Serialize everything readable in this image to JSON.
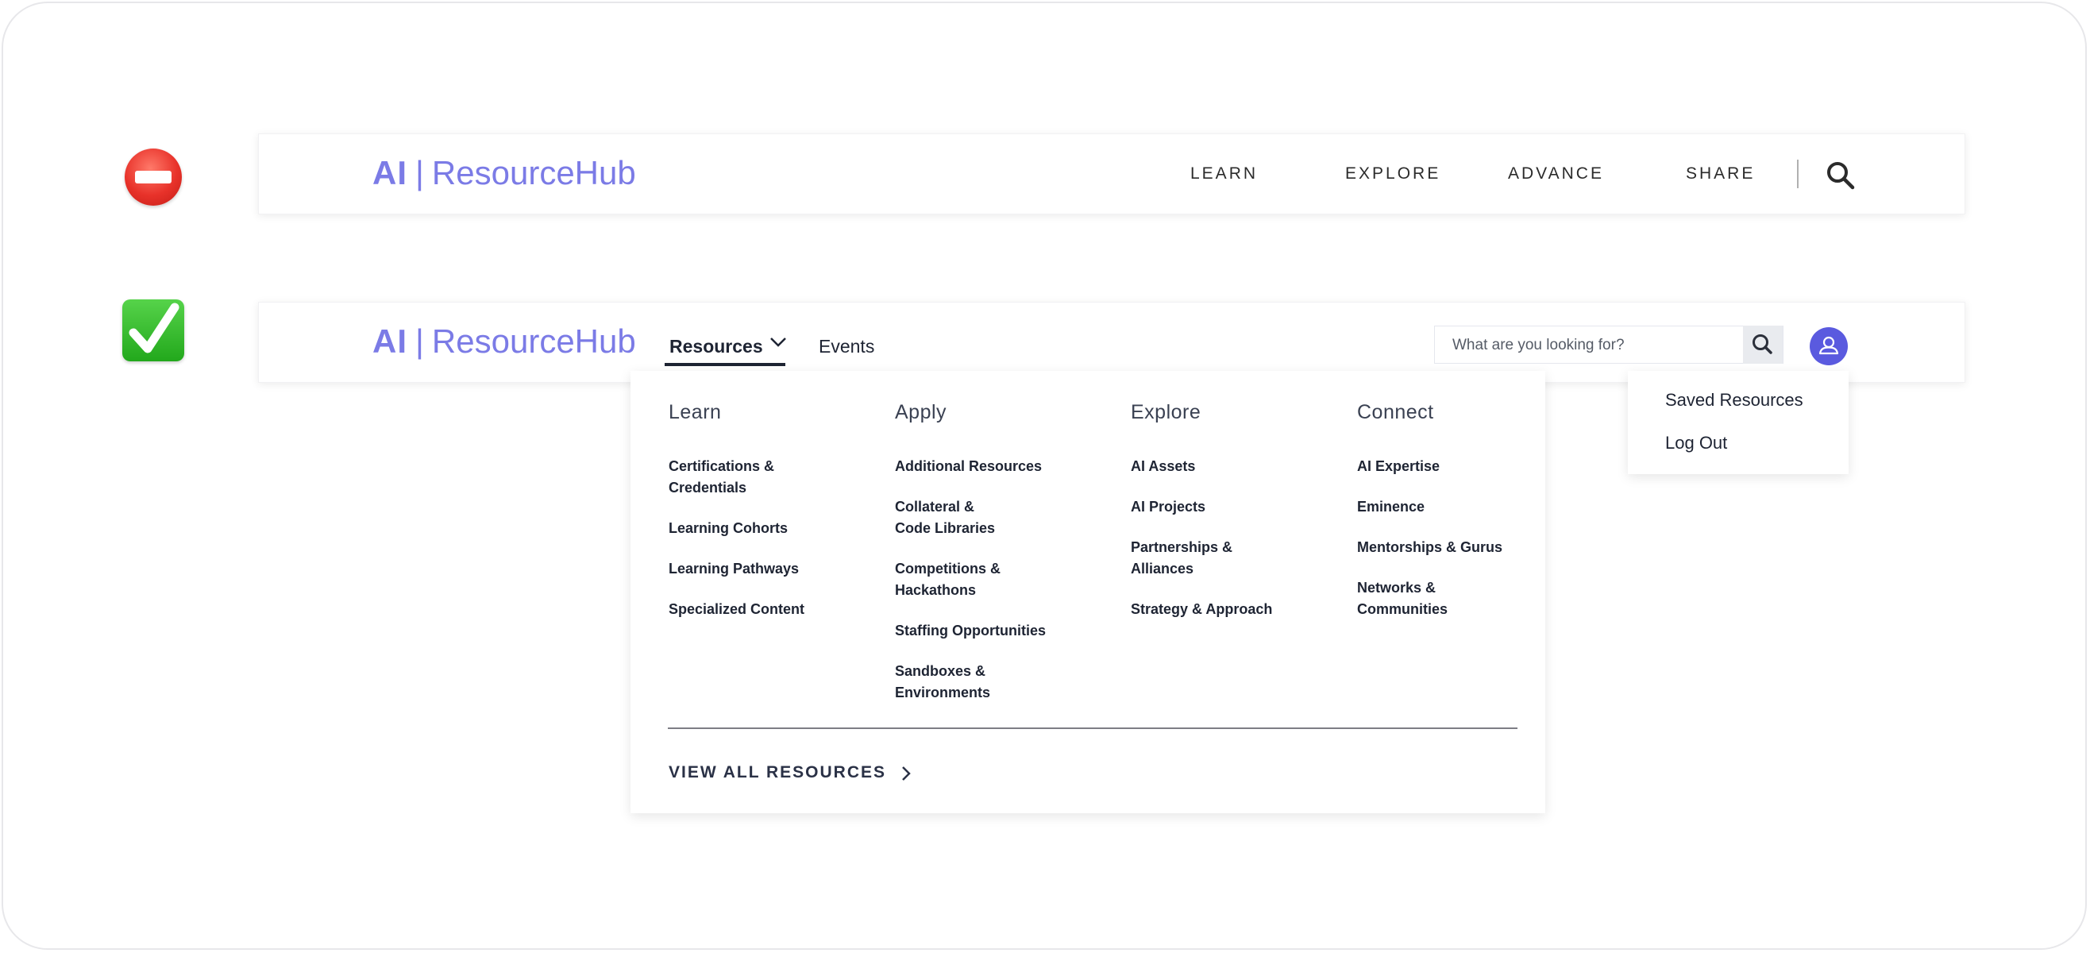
{
  "logo": {
    "ai": "AI",
    "separator": "|",
    "name": "ResourceHub"
  },
  "old_nav": {
    "items": [
      "LEARN",
      "EXPLORE",
      "ADVANCE",
      "SHARE"
    ]
  },
  "new_nav": {
    "resources_label": "Resources",
    "events_label": "Events",
    "search_placeholder": "What are you looking for?"
  },
  "mega_menu": {
    "columns": [
      {
        "heading": "Learn",
        "items": [
          "Certifications &\nCredentials",
          "Learning Cohorts",
          "Learning Pathways",
          "Specialized Content"
        ]
      },
      {
        "heading": "Apply",
        "items": [
          "Additional Resources",
          "Collateral &\nCode Libraries",
          "Competitions &\nHackathons",
          "Staffing Opportunities",
          "Sandboxes &\nEnvironments"
        ]
      },
      {
        "heading": "Explore",
        "items": [
          "AI Assets",
          "AI Projects",
          "Partnerships &\nAlliances",
          "Strategy & Approach"
        ]
      },
      {
        "heading": "Connect",
        "items": [
          "AI Expertise",
          "Eminence",
          "Mentorships & Gurus",
          "Networks &\nCommunities"
        ]
      }
    ],
    "view_all_label": "VIEW ALL RESOURCES"
  },
  "user_menu": {
    "items": [
      "Saved Resources",
      "Log Out"
    ]
  },
  "colors": {
    "brand": "#7b7be6",
    "avatar": "#5a5adf",
    "text_dark": "#1e2433"
  },
  "icons": [
    "no-entry-icon",
    "check-mark-icon",
    "search-icon",
    "chevron-down-icon",
    "user-icon",
    "chevron-right-icon"
  ]
}
